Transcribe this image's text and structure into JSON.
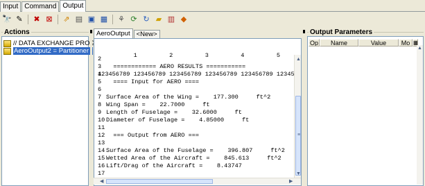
{
  "top_tabs": [
    "Input",
    "Command",
    "Output"
  ],
  "toolbar": {
    "buttons": [
      {
        "name": "binoculars-icon",
        "glyph": "🔭"
      },
      {
        "name": "edit-icon",
        "glyph": "✎"
      },
      {
        "name": "delete-icon",
        "glyph": "✖"
      },
      {
        "name": "clear-icon",
        "glyph": "⊠"
      },
      {
        "name": "export-icon",
        "glyph": "⇗"
      },
      {
        "name": "document-icon",
        "glyph": "▤"
      },
      {
        "name": "save-icon",
        "glyph": "▣"
      },
      {
        "name": "grid-icon",
        "glyph": "▦"
      },
      {
        "name": "tree-icon",
        "glyph": "⚘"
      },
      {
        "name": "refresh-icon",
        "glyph": "⟳"
      },
      {
        "name": "rotate-icon",
        "glyph": "↻"
      },
      {
        "name": "folder-icon",
        "glyph": "▰"
      },
      {
        "name": "list-icon",
        "glyph": "▥"
      },
      {
        "name": "run-icon",
        "glyph": "◆"
      }
    ]
  },
  "actions": {
    "title": "Actions",
    "items": [
      "// DATA EXCHANGE PROG",
      "AeroOutput2 = Partitioner /"
    ]
  },
  "output": {
    "tabs": [
      "AeroOutput",
      "<New>"
    ],
    "ruler_numbers": "          1         2         3         4         5         6",
    "ruler_digits": "123456789 123456789 123456789 123456789 123456789 123456789",
    "lines": [
      {
        "n": "2",
        "text": ""
      },
      {
        "n": "3",
        "text": "  ============ AERO RESULTS ==========="
      },
      {
        "n": "4",
        "text": ""
      },
      {
        "n": "5",
        "text": "  ==== Input for AERO ===="
      },
      {
        "n": "6",
        "text": ""
      },
      {
        "n": "7",
        "text": "Surface Area of the Wing =    177.300     ft^2"
      },
      {
        "n": "8",
        "text": "Wing Span =    22.7000     ft"
      },
      {
        "n": "9",
        "text": "Length of Fuselage =    32.6000     ft"
      },
      {
        "n": "10",
        "text": "Diameter of Fuselage =    4.85000     ft"
      },
      {
        "n": "11",
        "text": ""
      },
      {
        "n": "12",
        "text": "  === Output from AERO ==="
      },
      {
        "n": "13",
        "text": ""
      },
      {
        "n": "14",
        "text": "Surface Area of the Fuselage =    396.807     ft^2"
      },
      {
        "n": "15",
        "text": "Wetted Area of the Aircraft =    845.613     ft^2"
      },
      {
        "n": "16",
        "text": "Lift/Drag of the Aircraft =    8.43747"
      },
      {
        "n": "17",
        "text": ""
      }
    ]
  },
  "params": {
    "title": "Output Parameters",
    "columns": [
      "Op",
      "Name",
      "Value",
      "Mo"
    ]
  }
}
